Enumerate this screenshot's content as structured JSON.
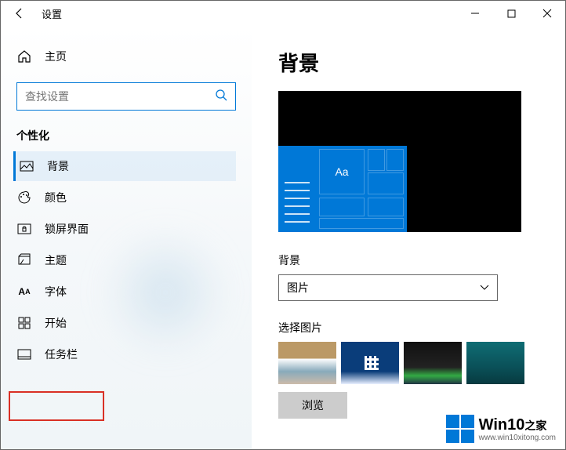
{
  "titlebar": {
    "title": "设置"
  },
  "sidebar": {
    "home": "主页",
    "search_placeholder": "查找设置",
    "section": "个性化",
    "items": [
      {
        "label": "背景"
      },
      {
        "label": "颜色"
      },
      {
        "label": "锁屏界面"
      },
      {
        "label": "主题"
      },
      {
        "label": "字体"
      },
      {
        "label": "开始"
      },
      {
        "label": "任务栏"
      }
    ]
  },
  "main": {
    "heading": "背景",
    "preview_tile_text": "Aa",
    "bg_label": "背景",
    "bg_value": "图片",
    "select_label": "选择图片",
    "browse": "浏览"
  },
  "watermark": {
    "brand": "Win10",
    "suffix": "之家",
    "url": "www.win10xitong.com"
  }
}
